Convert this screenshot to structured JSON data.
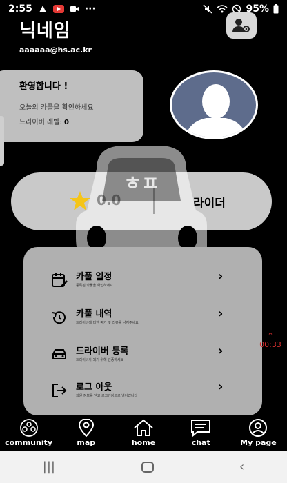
{
  "status_bar": {
    "time": "2:55",
    "battery": "95%"
  },
  "header": {
    "nickname": "닉네임",
    "email": "aaaaaa@hs.ac.kr"
  },
  "welcome": {
    "title": "환영합니다 !",
    "subtitle": "오늘의 카풀을 확인하세요",
    "level_label": "드라이버 레벨:",
    "level_value": "0"
  },
  "rating": {
    "value": "0.0",
    "role": "라이더"
  },
  "watermark": {
    "text": "ㅎㅍ"
  },
  "menu": [
    {
      "title": "카풀 일정",
      "subtitle": "등록된 카풀을 확인하세요",
      "icon": "calendar-edit-icon"
    },
    {
      "title": "카풀 내역",
      "subtitle": "드라이버에 대한 평가 및 리뷰를 남겨주세요",
      "icon": "history-icon"
    },
    {
      "title": "드라이버 등록",
      "subtitle": "드라이버가 되기 위해 인증하세요",
      "icon": "car-icon"
    },
    {
      "title": "로그 아웃",
      "subtitle": "회원 정보를 닫고 로그인창으로 넘어갑니다",
      "icon": "logout-icon"
    }
  ],
  "floating_timer": {
    "time": "00:33"
  },
  "bottom_nav": [
    {
      "label": "community",
      "icon": "community-icon"
    },
    {
      "label": "map",
      "icon": "map-pin-icon"
    },
    {
      "label": "home",
      "icon": "home-icon"
    },
    {
      "label": "chat",
      "icon": "chat-icon"
    },
    {
      "label": "My page",
      "icon": "user-circle-icon"
    }
  ],
  "colors": {
    "background": "#000000",
    "card": "#bfbfbf",
    "avatar_bg": "#5e6c8c",
    "star": "#f5c518",
    "timer": "#d32f2f"
  }
}
